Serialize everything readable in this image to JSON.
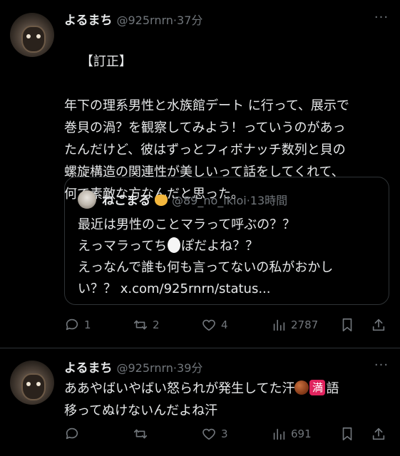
{
  "tweets": [
    {
      "name": "よるまち",
      "handle": "@925rnrn",
      "dot": "·",
      "time": "37分",
      "text": "【訂正】\n\n年下の理系男性と水族館デート に行って、展示で\n巻貝の渦？を観察してみよう！っていうのがあっ\nたんだけど、彼はずっとフィボナッチ数列と貝の\n螺旋構造の関連性が美しいって話をしてくれて、\n何で素敵な方なんだと思った。",
      "quote": {
        "name": "ねこまる",
        "handle": "@89_no_ikioi",
        "dot": "·",
        "time": "13時間",
        "line1": "最近は男性のことマラって呼ぶの？？",
        "line2a": "えっマラってち",
        "line2b": "ぽだよね？？",
        "line3": "えっなんで誰も何も言ってないの私がおかし",
        "line4": "い？？ x.com/925rnrn/status..."
      },
      "actions": {
        "replies": "1",
        "retweets": "2",
        "likes": "4",
        "views": "2787"
      }
    },
    {
      "name": "よるまち",
      "handle": "@925rnrn",
      "dot": "·",
      "time": "39分",
      "text_a": "ああやばいやばい怒られが発生してた汗",
      "emoji_man": "満",
      "text_b": "語",
      "text_c": "移ってぬけないんだよね汗",
      "actions": {
        "replies": "",
        "retweets": "",
        "likes": "3",
        "views": "691"
      }
    }
  ],
  "icons": [
    "reply-icon",
    "retweet-icon",
    "like-icon",
    "views-icon",
    "bookmark-icon",
    "share-icon",
    "more-icon"
  ]
}
